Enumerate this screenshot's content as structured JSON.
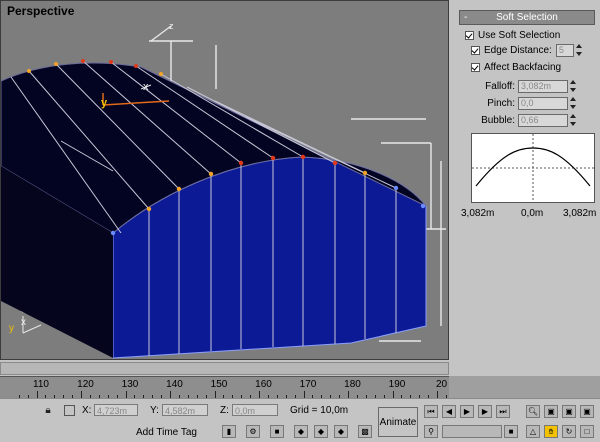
{
  "viewport": {
    "label": "Perspective",
    "axis_y": "y",
    "axis_x": "x",
    "axis_z": "z",
    "mini_axis_y": "y",
    "mini_axis_x": "x",
    "colors": {
      "mesh_face": "#0d1a96",
      "mesh_top": "#030322",
      "selected_vertex": "#e1391c",
      "soft_vertex": "#f2a32a",
      "wire": "#e0e0e0"
    }
  },
  "soft_selection": {
    "title": "Soft Selection",
    "collapse_symbol": "-",
    "use_soft_selection": {
      "label": "Use Soft Selection",
      "checked": true
    },
    "edge_distance": {
      "label": "Edge Distance:",
      "checked": true,
      "value": "5"
    },
    "affect_backfacing": {
      "label": "Affect Backfacing",
      "checked": true
    },
    "falloff": {
      "label": "Falloff:",
      "value": "3,082m"
    },
    "pinch": {
      "label": "Pinch:",
      "value": "0,0"
    },
    "bubble": {
      "label": "Bubble:",
      "value": "0,66"
    },
    "curve_labels": {
      "left": "3,082m",
      "center": "0,0m",
      "right": "3,082m"
    }
  },
  "timeline": {
    "ticks": [
      "110",
      "120",
      "130",
      "140",
      "150",
      "160",
      "170",
      "180",
      "190",
      "20"
    ]
  },
  "statusbar": {
    "x_label": "X:",
    "x_value": "4,723m",
    "y_label": "Y:",
    "y_value": "4,582m",
    "z_label": "Z:",
    "z_value": "0,0m",
    "grid": "Grid = 10,0m",
    "add_time_tag": "Add Time Tag",
    "animate": "Animate"
  }
}
